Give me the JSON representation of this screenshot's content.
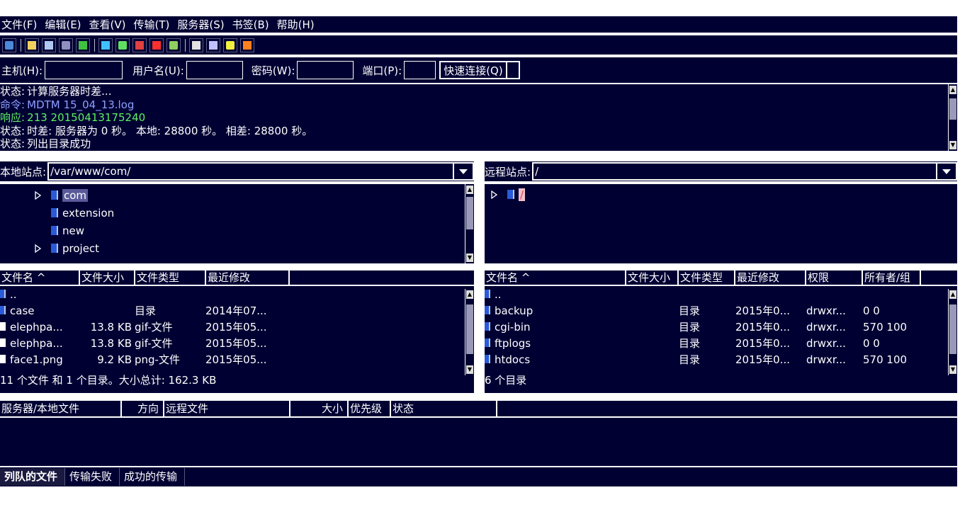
{
  "menu": [
    "文件(F)",
    "编辑(E)",
    "查看(V)",
    "传输(T)",
    "服务器(S)",
    "书签(B)",
    "帮助(H)"
  ],
  "toolbar": {
    "icons": [
      "site-manager-icon",
      "toggle-log-icon",
      "toggle-local-tree-icon",
      "toggle-remote-tree-icon",
      "toggle-queue-icon",
      "refresh-icon",
      "process-queue-icon",
      "cancel-icon",
      "disconnect-icon",
      "reconnect-icon",
      "filter-icon",
      "compare-icon",
      "sync-browse-icon",
      "search-icon"
    ],
    "colors": {
      "site": "#4a8ad8",
      "log": "#f0d060",
      "tree": "#b0c8f0",
      "queue": "#9090c0",
      "sync": "#40c040",
      "refresh": "#40c0ff",
      "process": "#60e060",
      "flag": "#e04040",
      "cancel": "#ff3030",
      "reconnect": "#90d060",
      "filter": "#e0e0e0",
      "compare": "#c0c0ff",
      "browse": "#f0f040",
      "search": "#ff8020"
    }
  },
  "quickconnect": {
    "host_label": "主机(H):",
    "host_value": "",
    "user_label": "用户名(U):",
    "user_value": "",
    "pass_label": "密码(W):",
    "pass_value": "",
    "port_label": "端口(P):",
    "port_value": "",
    "connect_label": "快速连接(Q)"
  },
  "log": [
    {
      "text": "状态:\t计算服务器时差...",
      "color": "#ffffff"
    },
    {
      "text": "命令:\tMDTM 15_04_13.log",
      "color": "#8ea0ff"
    },
    {
      "text": "响应:\t213 20150413175240",
      "color": "#60f060"
    },
    {
      "text": "状态:\t时差: 服务器为 0 秒。 本地: 28800 秒。 相差: 28800 秒。",
      "color": "#ffffff"
    },
    {
      "text": "状态:\t列出目录成功",
      "color": "#ffffff"
    }
  ],
  "local": {
    "site_label": "本地站点:",
    "path": "/var/www/com/",
    "tree": [
      {
        "name": "com",
        "expandable": true,
        "selected": true
      },
      {
        "name": "extension",
        "expandable": false,
        "selected": false
      },
      {
        "name": "new",
        "expandable": false,
        "selected": false
      },
      {
        "name": "project",
        "expandable": true,
        "selected": false
      }
    ],
    "columns": [
      "文件名 ^",
      "文件大小",
      "文件类型",
      "最近修改"
    ],
    "files": [
      {
        "name": "..",
        "size": "",
        "type": "",
        "modified": "",
        "dir": true
      },
      {
        "name": "case",
        "size": "",
        "type": "目录",
        "modified": "2014年07...",
        "dir": true
      },
      {
        "name": "elephpa...",
        "size": "13.8 KB",
        "type": "gif-文件",
        "modified": "2015年05...",
        "dir": false
      },
      {
        "name": "elephpa...",
        "size": "13.8 KB",
        "type": "gif-文件",
        "modified": "2015年05...",
        "dir": false
      },
      {
        "name": "face1.png",
        "size": "9.2 KB",
        "type": "png-文件",
        "modified": "2015年05...",
        "dir": false
      }
    ],
    "status": "11 个文件 和 1 个目录。大小总计: 162.3 KB"
  },
  "remote": {
    "site_label": "远程站点:",
    "path": "/",
    "tree": [
      {
        "name": "/",
        "expandable": true,
        "selected": true
      }
    ],
    "columns": [
      "文件名 ^",
      "文件大小",
      "文件类型",
      "最近修改",
      "权限",
      "所有者/组"
    ],
    "files": [
      {
        "name": "..",
        "size": "",
        "type": "",
        "modified": "",
        "perms": "",
        "owner": "",
        "dir": true
      },
      {
        "name": "backup",
        "size": "",
        "type": "目录",
        "modified": "2015年0...",
        "perms": "drwxr...",
        "owner": "0 0",
        "dir": true
      },
      {
        "name": "cgi-bin",
        "size": "",
        "type": "目录",
        "modified": "2015年0...",
        "perms": "drwxr...",
        "owner": "570 100",
        "dir": true
      },
      {
        "name": "ftplogs",
        "size": "",
        "type": "目录",
        "modified": "2015年0...",
        "perms": "drwxr...",
        "owner": "0 0",
        "dir": true
      },
      {
        "name": "htdocs",
        "size": "",
        "type": "目录",
        "modified": "2015年0...",
        "perms": "drwxr...",
        "owner": "570 100",
        "dir": true
      }
    ],
    "status": "6 个目录"
  },
  "queue": {
    "columns": [
      "服务器/本地文件",
      "方向",
      "远程文件",
      "大小",
      "优先级",
      "状态"
    ],
    "tabs": [
      "列队的文件",
      "传输失败",
      "成功的传输"
    ],
    "active_tab": 0
  }
}
